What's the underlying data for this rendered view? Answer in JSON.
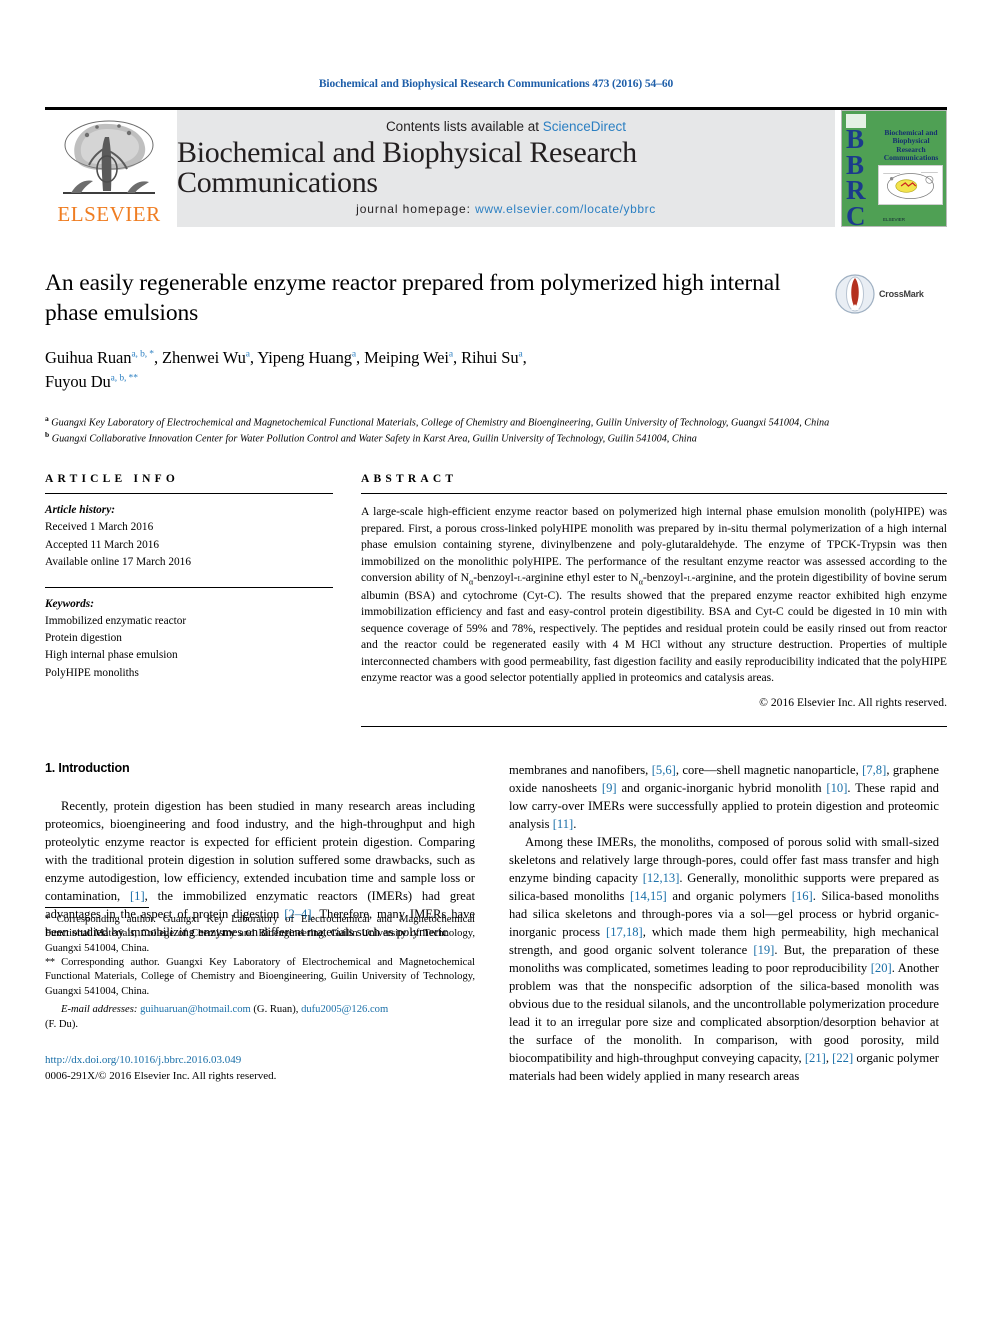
{
  "running_head": "Biochemical and Biophysical Research Communications 473 (2016) 54–60",
  "masthead": {
    "contents_prefix": "Contents lists available at ",
    "sciencedirect": "ScienceDirect",
    "journal_title": "Biochemical and Biophysical Research Communications",
    "homepage_label": "journal homepage: ",
    "homepage_url": "www.elsevier.com/locate/ybbrc",
    "publisher": "ELSEVIER",
    "cover": {
      "letters": "BBRC",
      "title": "Biochemical and Biophysical Research Communications",
      "footer": "ELSEVIER"
    },
    "colors": {
      "link": "#2b7fc2",
      "elsevier_orange": "#ef7d22",
      "panel": "#e6e7e8",
      "cover_green": "#4fa054"
    }
  },
  "article": {
    "title": "An easily regenerable enzyme reactor prepared from polymerized high internal phase emulsions",
    "authors_line1": "Guihua Ruan a, b, *, Zhenwei Wu a, Yipeng Huang a, Meiping Wei a, Rihui Su a,",
    "authors_line2": "Fuyou Du a, b, **",
    "authors": [
      {
        "name": "Guihua Ruan",
        "marks": "a, b, *"
      },
      {
        "name": "Zhenwei Wu",
        "marks": "a"
      },
      {
        "name": "Yipeng Huang",
        "marks": "a"
      },
      {
        "name": "Meiping Wei",
        "marks": "a"
      },
      {
        "name": "Rihui Su",
        "marks": "a"
      },
      {
        "name": "Fuyou Du",
        "marks": "a, b, **"
      }
    ],
    "crossmark_label": "CrossMark",
    "affiliations": [
      {
        "mark": "a",
        "text": "Guangxi Key Laboratory of Electrochemical and Magnetochemical Functional Materials, College of Chemistry and Bioengineering, Guilin University of Technology, Guangxi 541004, China"
      },
      {
        "mark": "b",
        "text": "Guangxi Collaborative Innovation Center for Water Pollution Control and Water Safety in Karst Area, Guilin University of Technology, Guilin 541004, China"
      }
    ]
  },
  "info": {
    "heading": "ARTICLE INFO",
    "history_label": "Article history:",
    "history": [
      "Received 1 March 2016",
      "Accepted 11 March 2016",
      "Available online 17 March 2016"
    ],
    "keywords_label": "Keywords:",
    "keywords": [
      "Immobilized enzymatic reactor",
      "Protein digestion",
      "High internal phase emulsion",
      "PolyHIPE monoliths"
    ]
  },
  "abstract": {
    "heading": "ABSTRACT",
    "text_part1": "A large-scale high-efficient enzyme reactor based on polymerized high internal phase emulsion monolith (polyHIPE) was prepared. First, a porous cross-linked polyHIPE monolith was prepared by in-situ thermal polymerization of a high internal phase emulsion containing styrene, divinylbenzene and poly-glutaraldehyde. The enzyme of TPCK-Trypsin was then immobilized on the monolithic polyHIPE. The performance of the resultant enzyme reactor was assessed according to the conversion ability of N",
    "alpha1": "α",
    "text_part2": "-benzoyl-",
    "lsc1": "l",
    "text_part3": "-arginine ethyl ester to N",
    "alpha2": "α",
    "text_part4": "-benzoyl-",
    "lsc2": "l",
    "text_part5": "-arginine, and the protein digestibility of bovine serum albumin (BSA) and cytochrome (Cyt-C). The results showed that the prepared enzyme reactor exhibited high enzyme immobilization efficiency and fast and easy-control protein digestibility. BSA and Cyt-C could be digested in 10 min with sequence coverage of 59% and 78%, respectively. The peptides and residual protein could be easily rinsed out from reactor and the reactor could be regenerated easily with 4 M HCl without any structure destruction. Properties of multiple interconnected chambers with good permeability, fast digestion facility and easily reproducibility indicated that the polyHIPE enzyme reactor was a good selector potentially applied in proteomics and catalysis areas.",
    "copyright": "© 2016 Elsevier Inc. All rights reserved."
  },
  "body": {
    "section_number_title": "1. Introduction",
    "left_para1_a": "Recently, protein digestion has been studied in many research areas including proteomics, bioengineering and food industry, and the high-throughput and high proteolytic enzyme reactor is expected for efficient protein digestion. Comparing with the traditional protein digestion in solution suffered some drawbacks, such as enzyme autodigestion, low efficiency, extended incubation time and sample loss or contamination, ",
    "left_ref1": "[1]",
    "left_para1_b": ", the immobilized enzymatic reactors (IMERs) had great advantages in the aspect of protein digestion ",
    "left_ref2": "[2–4]",
    "left_para1_c": ". Therefore, many IMERs have been studied by immobilizing enzymes on different materials such as polymeric",
    "right_para1_a": "membranes and nanofibers, ",
    "right_ref5": "[5,6]",
    "right_para1_b": ", core—shell magnetic nanoparticle, ",
    "right_ref7": "[7,8]",
    "right_para1_c": ", graphene oxide nanosheets ",
    "right_ref9": "[9]",
    "right_para1_d": " and organic-inorganic hybrid monolith ",
    "right_ref10": "[10]",
    "right_para1_e": ". These rapid and low carry-over IMERs were successfully applied to protein digestion and proteomic analysis ",
    "right_ref11": "[11]",
    "right_para1_f": ".",
    "right_para2_a": "Among these IMERs, the monoliths, composed of porous solid with small-sized skeletons and relatively large through-pores, could offer fast mass transfer and high enzyme binding capacity ",
    "right_ref1213": "[12,13]",
    "right_para2_b": ". Generally, monolithic supports were prepared as silica-based monoliths ",
    "right_ref1415": "[14,15]",
    "right_para2_c": " and organic polymers ",
    "right_ref16": "[16]",
    "right_para2_d": ". Silica-based monoliths had silica skeletons and through-pores via a sol—gel process or hybrid organic-inorganic process ",
    "right_ref1718": "[17,18]",
    "right_para2_e": ", which made them high permeability, high mechanical strength, and good organic solvent tolerance ",
    "right_ref19": "[19]",
    "right_para2_f": ". But, the preparation of these monoliths was complicated, sometimes leading to poor reproducibility ",
    "right_ref20": "[20]",
    "right_para2_g": ". Another problem was that the nonspecific adsorption of the silica-based monolith was obvious due to the residual silanols, and the uncontrollable polymerization procedure lead it to an irregular pore size and complicated absorption/desorption behavior at the surface of the monolith. In comparison, with good porosity, mild biocompatibility and high-throughput conveying capacity, ",
    "right_ref21": "[21]",
    "right_para2_h": ", ",
    "right_ref22": "[22]",
    "right_para2_i": " organic polymer materials had been widely applied in many research areas"
  },
  "footnotes": {
    "note1_mark": "*",
    "note1": " Corresponding author. Guangxi Key Laboratory of Electrochemical and Magnetochemical Functional Materials, College of Chemistry and Bioengineering, Guilin University of Technology, Guangxi 541004, China.",
    "note2_mark": "**",
    "note2": " Corresponding author. Guangxi Key Laboratory of Electrochemical and Magnetochemical Functional Materials, College of Chemistry and Bioengineering, Guilin University of Technology, Guangxi 541004, China.",
    "email_label": "E-mail addresses:",
    "email1": "guihuaruan@hotmail.com",
    "email1_owner": "(G. Ruan),",
    "email2": "dufu2005@126.com",
    "email2_owner": "(F. Du).",
    "doi": "http://dx.doi.org/10.1016/j.bbrc.2016.03.049",
    "issn": "0006-291X/© 2016 Elsevier Inc. All rights reserved."
  }
}
